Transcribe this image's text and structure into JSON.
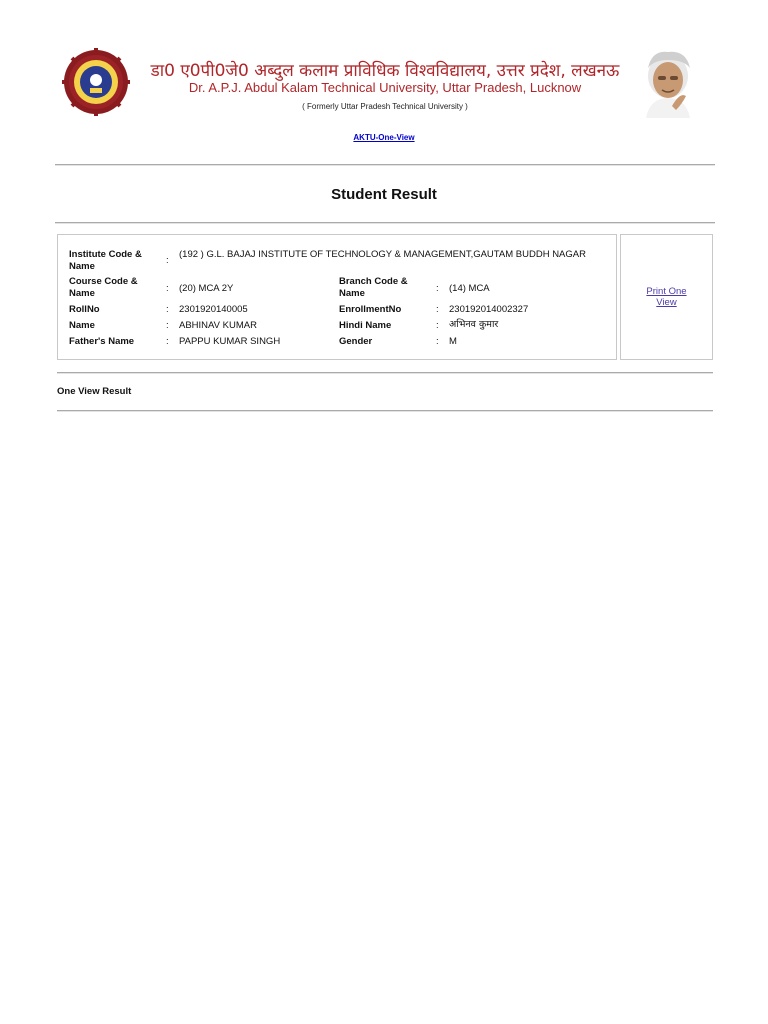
{
  "header": {
    "hindi_title": "डा0 ए0पी0जे0 अब्दुल कलाम प्राविधिक विश्वविद्यालय, उत्तर प्रदेश, लखनऊ",
    "english_title": "Dr. A.P.J. Abdul Kalam Technical University, Uttar Pradesh, Lucknow",
    "former_name": "( Formerly Uttar Pradesh Technical University )",
    "brand_color": "#b0262a"
  },
  "nav": {
    "one_view_link": "AKTU-One-View"
  },
  "page": {
    "title": "Student Result"
  },
  "student": {
    "institute": {
      "label": "Institute Code & Name",
      "value": "(192 ) G.L. BAJAJ INSTITUTE OF TECHNOLOGY & MANAGEMENT,GAUTAM BUDDH NAGAR"
    },
    "course": {
      "label": "Course Code & Name",
      "value": "(20) MCA 2Y"
    },
    "branch": {
      "label": "Branch Code & Name",
      "value": "(14) MCA"
    },
    "rollno": {
      "label": "RollNo",
      "value": "2301920140005"
    },
    "enrollment": {
      "label": "EnrollmentNo",
      "value": "230192014002327"
    },
    "name": {
      "label": "Name",
      "value": "ABHINAV KUMAR"
    },
    "hindi_name": {
      "label": "Hindi Name",
      "value": "अभिनव कुमार"
    },
    "father": {
      "label": "Father's Name",
      "value": "PAPPU KUMAR SINGH"
    },
    "gender": {
      "label": "Gender",
      "value": "M"
    },
    "separator": ":"
  },
  "actions": {
    "print_one_view": "Print One View"
  },
  "sections": {
    "one_view_result": "One View Result"
  },
  "icons": {
    "logo": "university-logo-icon",
    "portrait": "apj-kalam-portrait-icon"
  }
}
